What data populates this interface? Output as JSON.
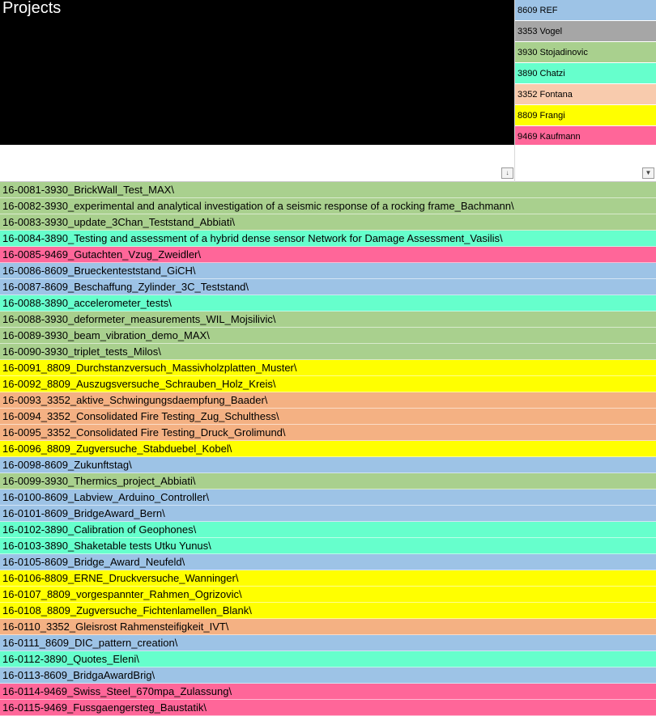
{
  "header": {
    "title": "Projects"
  },
  "colors": {
    "ref": "#9dc3e6",
    "vogel": "#a6a6a6",
    "stojadinovic": "#a9d08e",
    "chatzi": "#66ffcc",
    "fontana": "#f8cbad",
    "fontana_rows": "#f4b183",
    "frangi": "#ffff00",
    "kaufmann": "#ff6699"
  },
  "legend": [
    {
      "label": "8609 REF",
      "color": "#9dc3e6"
    },
    {
      "label": "3353 Vogel",
      "color": "#a6a6a6"
    },
    {
      "label": "3930 Stojadinovic",
      "color": "#a9d08e"
    },
    {
      "label": "3890 Chatzi",
      "color": "#66ffcc"
    },
    {
      "label": "3352 Fontana",
      "color": "#f8cbad"
    },
    {
      "label": "8809 Frangi",
      "color": "#ffff00"
    },
    {
      "label": "9469 Kaufmann",
      "color": "#ff6699"
    }
  ],
  "filter": {
    "icon_sorted": "↓",
    "icon_dropdown": "▼"
  },
  "rows": [
    {
      "text": "16-0081-3930_BrickWall_Test_MAX\\",
      "color": "#a9d08e"
    },
    {
      "text": "16-0082-3930_experimental and analytical investigation of a seismic response of a rocking frame_Bachmann\\",
      "color": "#a9d08e"
    },
    {
      "text": "16-0083-3930_update_3Chan_Teststand_Abbiati\\",
      "color": "#a9d08e"
    },
    {
      "text": "16-0084-3890_Testing and assessment of a hybrid dense sensor Network for Damage Assessment_Vasilis\\",
      "color": "#66ffcc"
    },
    {
      "text": "16-0085-9469_Gutachten_Vzug_Zweidler\\",
      "color": "#ff6699"
    },
    {
      "text": "16-0086-8609_Brueckenteststand_GiCH\\",
      "color": "#9dc3e6"
    },
    {
      "text": "16-0087-8609_Beschaffung_Zylinder_3C_Teststand\\",
      "color": "#9dc3e6"
    },
    {
      "text": "16-0088-3890_accelerometer_tests\\",
      "color": "#66ffcc"
    },
    {
      "text": "16-0088-3930_deformeter_measurements_WIL_Mojsilivic\\",
      "color": "#a9d08e"
    },
    {
      "text": "16-0089-3930_beam_vibration_demo_MAX\\",
      "color": "#a9d08e"
    },
    {
      "text": "16-0090-3930_triplet_tests_Milos\\",
      "color": "#a9d08e"
    },
    {
      "text": "16-0091_8809_Durchstanzversuch_Massivholzplatten_Muster\\",
      "color": "#ffff00"
    },
    {
      "text": "16-0092_8809_Auszugsversuche_Schrauben_Holz_Kreis\\",
      "color": "#ffff00"
    },
    {
      "text": "16-0093_3352_aktive_Schwingungsdaempfung_Baader\\",
      "color": "#f4b183"
    },
    {
      "text": "16-0094_3352_Consolidated Fire Testing_Zug_Schulthess\\",
      "color": "#f4b183"
    },
    {
      "text": "16-0095_3352_Consolidated Fire Testing_Druck_Grolimund\\",
      "color": "#f4b183"
    },
    {
      "text": "16-0096_8809_Zugversuche_Stabduebel_Kobel\\",
      "color": "#ffff00"
    },
    {
      "text": "16-0098-8609_Zukunftstag\\",
      "color": "#9dc3e6"
    },
    {
      "text": "16-0099-3930_Thermics_project_Abbiati\\",
      "color": "#a9d08e"
    },
    {
      "text": "16-0100-8609_Labview_Arduino_Controller\\",
      "color": "#9dc3e6"
    },
    {
      "text": "16-0101-8609_BridgeAward_Bern\\",
      "color": "#9dc3e6"
    },
    {
      "text": "16-0102-3890_Calibration of Geophones\\",
      "color": "#66ffcc"
    },
    {
      "text": "16-0103-3890_Shaketable tests Utku Yunus\\",
      "color": "#66ffcc"
    },
    {
      "text": "16-0105-8609_Bridge_Award_Neufeld\\",
      "color": "#9dc3e6"
    },
    {
      "text": "16-0106-8809_ERNE_Druckversuche_Wanninger\\",
      "color": "#ffff00"
    },
    {
      "text": "16-0107_8809_vorgespannter_Rahmen_Ogrizovic\\",
      "color": "#ffff00"
    },
    {
      "text": "16-0108_8809_Zugversuche_Fichtenlamellen_Blank\\",
      "color": "#ffff00"
    },
    {
      "text": "16-0110_3352_Gleisrost Rahmensteifigkeit_IVT\\",
      "color": "#f4b183"
    },
    {
      "text": "16-0111_8609_DIC_pattern_creation\\",
      "color": "#9dc3e6"
    },
    {
      "text": "16-0112-3890_Quotes_Eleni\\",
      "color": "#66ffcc"
    },
    {
      "text": "16-0113-8609_BridgaAwardBrig\\",
      "color": "#9dc3e6"
    },
    {
      "text": "16-0114-9469_Swiss_Steel_670mpa_Zulassung\\",
      "color": "#ff6699"
    },
    {
      "text": "16-0115-9469_Fussgaengersteg_Baustatik\\",
      "color": "#ff6699"
    }
  ]
}
